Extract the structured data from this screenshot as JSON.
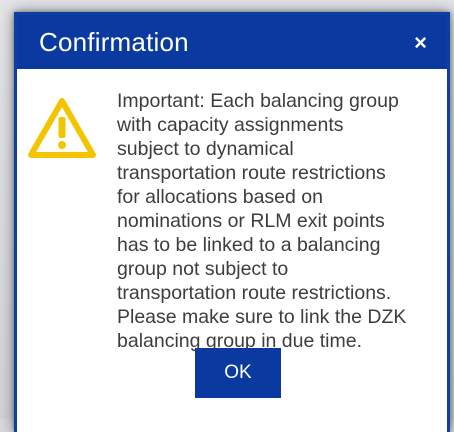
{
  "dialog": {
    "title": "Confirmation",
    "close_label": "×",
    "icon": "warning-triangle-icon",
    "message": "Important: Each balancing group with capacity assignments subject to dynamical transportation route restrictions for allocations based on nominations or RLM exit points has to be linked to a balancing group not subject to transportation route restrictions. Please make sure to link the DZK balancing group in due time.",
    "ok_label": "OK"
  },
  "colors": {
    "titlebar": "#0a3aa0",
    "warning": "#f2c500",
    "text": "#3d3d3d"
  }
}
